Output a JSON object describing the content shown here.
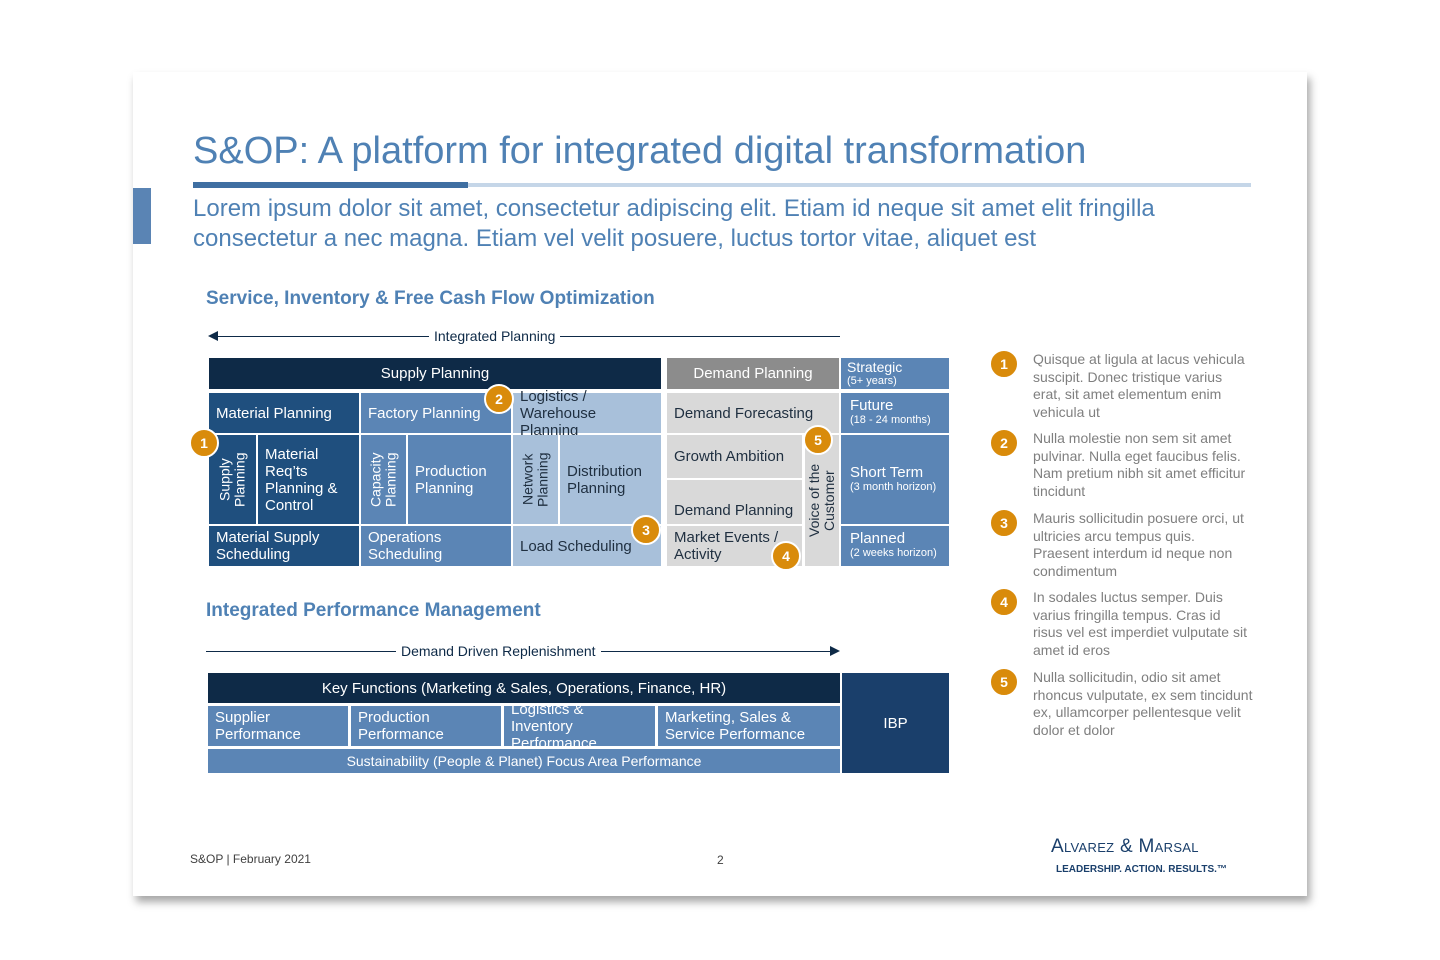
{
  "title": "S&OP: A platform for integrated digital transformation",
  "subtitle": "Lorem ipsum dolor sit amet, consectetur adipiscing elit. Etiam id neque sit amet elit fringilla consectetur a nec magna. Etiam vel velit posuere, luctus tortor vitae, aliquet est",
  "section1": {
    "heading": "Service, Inventory & Free Cash Flow Optimization",
    "arrow_label": "Integrated Planning",
    "supply_planning": "Supply Planning",
    "demand_planning_header": "Demand Planning",
    "material_planning": "Material Planning",
    "factory_planning": "Factory Planning",
    "logistics_warehouse": "Logistics / Warehouse Planning",
    "supply_planning_vert": "Supply Planning",
    "material_req": "Material Req’ts Planning & Control",
    "capacity_planning": "Capacity Planning",
    "production_planning": "Production Planning",
    "network_planning": "Network Planning",
    "distribution_planning": "Distribution Planning",
    "material_supply_scheduling": "Material Supply Scheduling",
    "operations_scheduling": "Operations Scheduling",
    "load_scheduling": "Load Scheduling",
    "demand_forecasting": "Demand Forecasting",
    "growth_ambition": "Growth Ambition",
    "demand_planning_cell": "Demand Planning",
    "market_events": "Market Events / Activity",
    "voice_of_customer": "Voice of the Customer",
    "horizons": {
      "strategic": "Strategic",
      "strategic_sub": "(5+ years)",
      "future": "Future",
      "future_sub": "(18 - 24 months)",
      "short_term": "Short Term",
      "short_term_sub": "(3 month horizon)",
      "planned": "Planned",
      "planned_sub": "(2 weeks horizon)"
    }
  },
  "section2": {
    "heading": "Integrated Performance Management",
    "arrow_label": "Demand Driven Replenishment",
    "key_functions": "Key Functions (Marketing & Sales, Operations, Finance, HR)",
    "supplier_perf": "Supplier Performance",
    "production_perf": "Production Performance",
    "logistics_perf": "Logistics & Inventory Performance",
    "marketing_perf": "Marketing, Sales & Service Performance",
    "sustainability": "Sustainability (People & Planet) Focus Area Performance",
    "ibp": "IBP"
  },
  "badges": [
    "1",
    "2",
    "3",
    "4",
    "5"
  ],
  "notes": [
    {
      "num": "1",
      "text": "Quisque at ligula at lacus vehicula suscipit. Donec tristique varius erat, sit amet elementum enim vehicula ut"
    },
    {
      "num": "2",
      "text": "Nulla molestie non sem sit amet pulvinar. Nulla eget faucibus felis. Nam pretium nibh sit amet efficitur tincidunt"
    },
    {
      "num": "3",
      "text": "Mauris sollicitudin posuere orci, ut ultricies arcu tempus quis. Praesent interdum id neque non condimentum"
    },
    {
      "num": "4",
      "text": "In sodales luctus semper. Duis varius fringilla tempus. Cras id risus vel est imperdiet vulputate sit amet id eros"
    },
    {
      "num": "5",
      "text": "Nulla sollicitudin, odio sit amet rhoncus vulputate, ex sem tincidunt ex, ullamcorper pellentesque velit dolor et dolor"
    }
  ],
  "footer": {
    "left": "S&OP | February 2021",
    "page": "2"
  },
  "logo": {
    "name": "Alvarez & Marsal",
    "tagline": "LEADERSHIP. ACTION. RESULTS.™"
  },
  "colors": {
    "accent": "#4f81b4",
    "navy": "#0e2a47",
    "badge": "#d98b0b"
  }
}
